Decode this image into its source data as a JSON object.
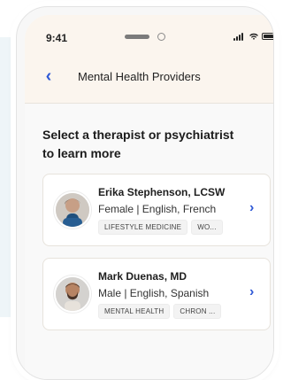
{
  "status_bar": {
    "time": "9:41"
  },
  "nav": {
    "title": "Mental Health Providers"
  },
  "page": {
    "title": "Select a therapist or psychiatrist to learn more"
  },
  "providers": [
    {
      "name": "Erika Stephenson, LCSW",
      "meta": "Female | English, French",
      "tags": [
        "LIFESTYLE MEDICINE",
        "WO..."
      ]
    },
    {
      "name": "Mark Duenas, MD",
      "meta": "Male | English, Spanish",
      "tags": [
        "MENTAL HEALTH",
        "CHRON ..."
      ]
    }
  ],
  "colors": {
    "accent": "#2f59d6",
    "header_bg": "#fbf5ee",
    "card_bg": "#ffffff",
    "page_bg": "#f9f9f9"
  },
  "icons": {
    "back": "chevron-left-icon",
    "signal": "signal-icon",
    "wifi": "wifi-icon",
    "battery": "battery-icon",
    "provider_chevron": "chevron-right-icon"
  }
}
